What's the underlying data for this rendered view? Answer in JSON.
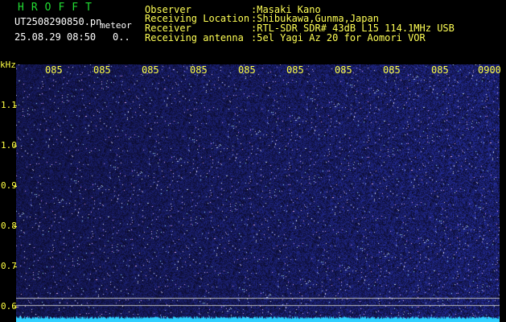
{
  "header": {
    "brand": "HROFFT",
    "filename": "UT2508290850.pn",
    "mode": "meteor",
    "timestamp": "25.08.29 08:50",
    "counter": "0..",
    "fields": [
      {
        "label": "Observer",
        "value": ":Masaki Kano"
      },
      {
        "label": "Receiving Location",
        "value": ":Shibukawa,Gunma,Japan"
      },
      {
        "label": "Receiver",
        "value": ":RTL-SDR SDR# 43dB L15 114.1MHz USB"
      },
      {
        "label": "Receiving antenna",
        "value": ":5el Yagi Az 20 for Aomori VOR"
      }
    ]
  },
  "spectrogram": {
    "unit_label": "kHz",
    "y_ticks": [
      "1.1",
      "1.0",
      "0.9",
      "0.8",
      "0.7",
      "0.6"
    ],
    "time_ticks": [
      "085",
      "085",
      "085",
      "085",
      "085",
      "085",
      "085",
      "085",
      "085",
      "0900"
    ],
    "colors": {
      "background": "#000000",
      "noise_base": "#101a5a",
      "noise_bright": "#3050ff",
      "baseline": "#30d0ff",
      "text": "#ffff44"
    }
  }
}
